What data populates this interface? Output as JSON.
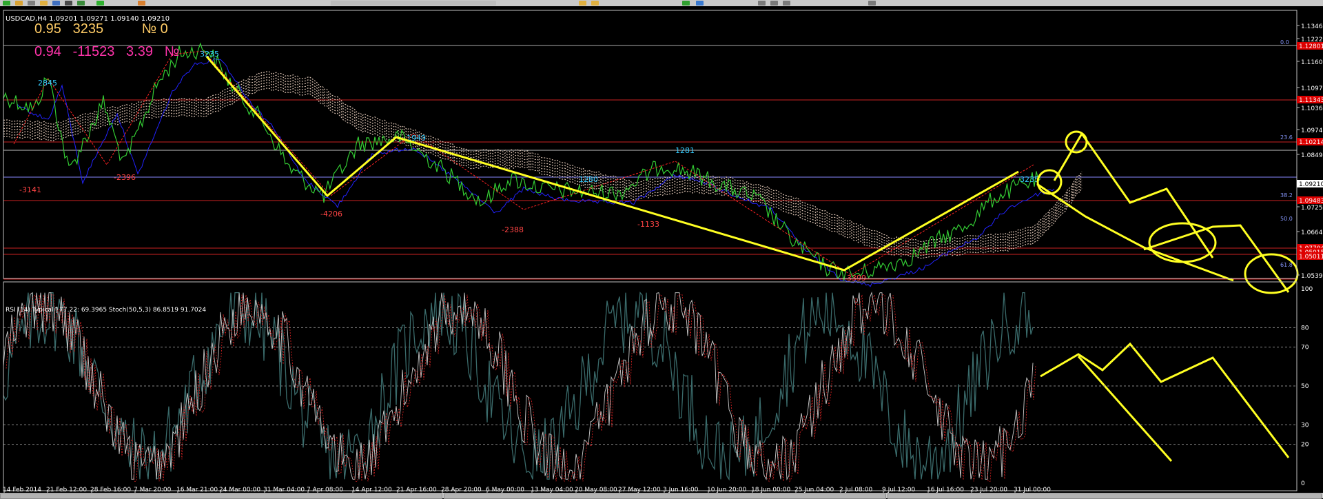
{
  "title": "USDCAD,H4  1.09201 1.09271 1.09140 1.09210",
  "stats": {
    "row1": "0.95   3235          № 0",
    "row2": "0.94   -11523   3.39   №"
  },
  "indicator_title": "RSI (14) Typical | 77.22: 69.3965  Stoch(50,5,3) 86.8519 91.7024",
  "price_levels": [
    "1.13465",
    "1.12220",
    "1.11605",
    "1.10975",
    "1.10360",
    "1.09745",
    "1.08495",
    "1.07870",
    "1.07255",
    "1.06640",
    "1.06015",
    "1.05395"
  ],
  "price_tags": {
    "current": "1.09210",
    "red": [
      "1.12801",
      "1.11343",
      "1.10214",
      "1.09483",
      "1.07704",
      "1.05015",
      "1.05011"
    ]
  },
  "fib_labels": [
    "0.0",
    "23.6",
    "38.2",
    "50.0",
    "61.8"
  ],
  "wave_labels": [
    "2845",
    "-3141",
    "-2396",
    "3235",
    "-4206",
    "1949",
    "-2388",
    "1280",
    "-1133",
    "1281",
    "-3399",
    "3235"
  ],
  "indicator_levels": [
    "100",
    "80",
    "70",
    "50",
    "30",
    "20",
    "0"
  ],
  "x_labels": [
    "14 Feb 2014",
    "21 Feb 12:00",
    "28 Feb 16:00",
    "7 Mar 20:00",
    "16 Mar 21:00",
    "24 Mar 00:00",
    "31 Mar 04:00",
    "7 Apr 08:00",
    "14 Apr 12:00",
    "21 Apr 16:00",
    "28 Apr 20:00",
    "6 May 00:00",
    "13 May 04:00",
    "20 May 08:00",
    "27 May 12:00",
    "3 Jun 16:00",
    "10 Jun 20:00",
    "18 Jun 00:00",
    "25 Jun 04:00",
    "2 Jul 08:00",
    "9 Jul 12:00",
    "16 Jul 16:00",
    "23 Jul 20:00",
    "31 Jul 00:00"
  ],
  "colors": {
    "background": "#000000",
    "price": "#33cc33",
    "drawing": "#ffff22",
    "level": "#cc2222",
    "kijun": "#2222ff",
    "zigzag": "#ff2222",
    "cloud": "#d8c0b0",
    "rsi": "#3a6b6b",
    "stoch_signal": "#dd2222"
  }
}
